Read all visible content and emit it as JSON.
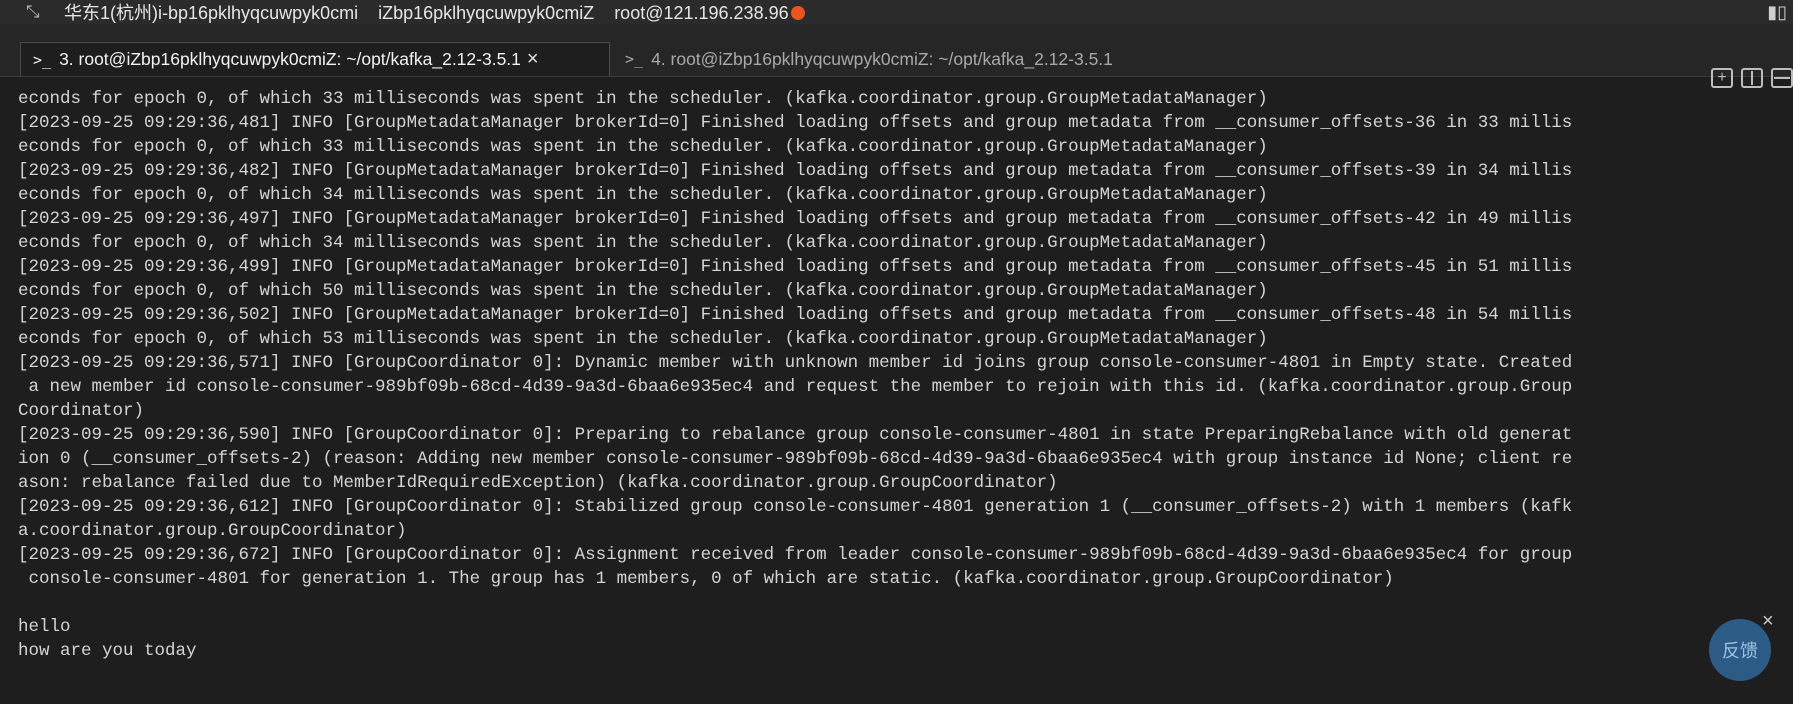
{
  "titlebar": {
    "region": "华东1(杭州)i-bp16pklhyqcuwpyk0cmi",
    "host": "iZbp16pklhyqcuwpyk0cmiZ",
    "login": "root@121.196.238.96"
  },
  "tabs": [
    {
      "label": "3. root@iZbp16pklhyqcuwpyk0cmiZ: ~/opt/kafka_2.12-3.5.1",
      "active": true
    },
    {
      "label": "4. root@iZbp16pklhyqcuwpyk0cmiZ: ~/opt/kafka_2.12-3.5.1",
      "active": false
    }
  ],
  "terminal": {
    "lines": [
      "econds for epoch 0, of which 33 milliseconds was spent in the scheduler. (kafka.coordinator.group.GroupMetadataManager)",
      "[2023-09-25 09:29:36,481] INFO [GroupMetadataManager brokerId=0] Finished loading offsets and group metadata from __consumer_offsets-36 in 33 millis",
      "econds for epoch 0, of which 33 milliseconds was spent in the scheduler. (kafka.coordinator.group.GroupMetadataManager)",
      "[2023-09-25 09:29:36,482] INFO [GroupMetadataManager brokerId=0] Finished loading offsets and group metadata from __consumer_offsets-39 in 34 millis",
      "econds for epoch 0, of which 34 milliseconds was spent in the scheduler. (kafka.coordinator.group.GroupMetadataManager)",
      "[2023-09-25 09:29:36,497] INFO [GroupMetadataManager brokerId=0] Finished loading offsets and group metadata from __consumer_offsets-42 in 49 millis",
      "econds for epoch 0, of which 34 milliseconds was spent in the scheduler. (kafka.coordinator.group.GroupMetadataManager)",
      "[2023-09-25 09:29:36,499] INFO [GroupMetadataManager brokerId=0] Finished loading offsets and group metadata from __consumer_offsets-45 in 51 millis",
      "econds for epoch 0, of which 50 milliseconds was spent in the scheduler. (kafka.coordinator.group.GroupMetadataManager)",
      "[2023-09-25 09:29:36,502] INFO [GroupMetadataManager brokerId=0] Finished loading offsets and group metadata from __consumer_offsets-48 in 54 millis",
      "econds for epoch 0, of which 53 milliseconds was spent in the scheduler. (kafka.coordinator.group.GroupMetadataManager)",
      "[2023-09-25 09:29:36,571] INFO [GroupCoordinator 0]: Dynamic member with unknown member id joins group console-consumer-4801 in Empty state. Created",
      " a new member id console-consumer-989bf09b-68cd-4d39-9a3d-6baa6e935ec4 and request the member to rejoin with this id. (kafka.coordinator.group.Group",
      "Coordinator)",
      "[2023-09-25 09:29:36,590] INFO [GroupCoordinator 0]: Preparing to rebalance group console-consumer-4801 in state PreparingRebalance with old generat",
      "ion 0 (__consumer_offsets-2) (reason: Adding new member console-consumer-989bf09b-68cd-4d39-9a3d-6baa6e935ec4 with group instance id None; client re",
      "ason: rebalance failed due to MemberIdRequiredException) (kafka.coordinator.group.GroupCoordinator)",
      "[2023-09-25 09:29:36,612] INFO [GroupCoordinator 0]: Stabilized group console-consumer-4801 generation 1 (__consumer_offsets-2) with 1 members (kafk",
      "a.coordinator.group.GroupCoordinator)",
      "[2023-09-25 09:29:36,672] INFO [GroupCoordinator 0]: Assignment received from leader console-consumer-989bf09b-68cd-4d39-9a3d-6baa6e935ec4 for group",
      " console-consumer-4801 for generation 1. The group has 1 members, 0 of which are static. (kafka.coordinator.group.GroupCoordinator)",
      "",
      "hello",
      "how are you today"
    ]
  },
  "feedback": {
    "label": "反馈",
    "close": "×"
  },
  "icons": {
    "tab_close": "×",
    "prompt": ">_"
  }
}
